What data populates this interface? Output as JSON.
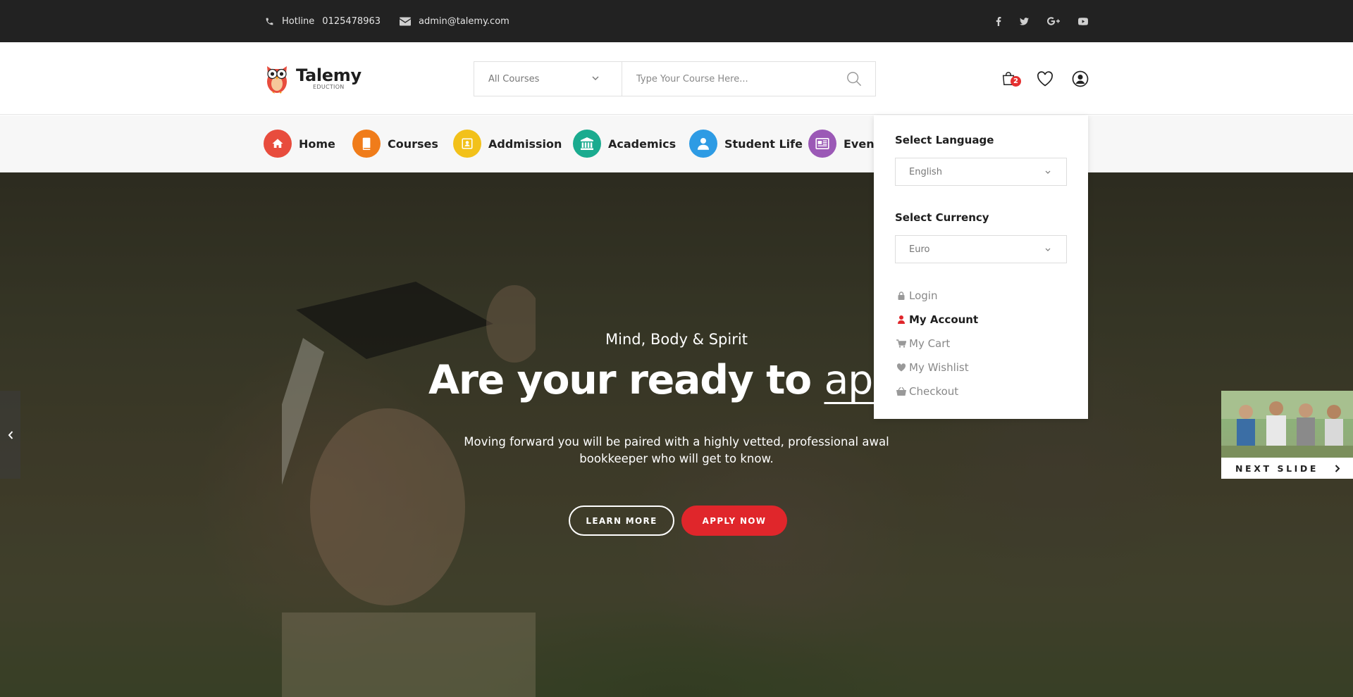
{
  "topbar": {
    "hotline_label": "Hotline",
    "hotline_number": "0125478963",
    "email": "admin@talemy.com",
    "social": [
      "facebook-icon",
      "twitter-icon",
      "google-plus-icon",
      "youtube-icon"
    ]
  },
  "header": {
    "logo_name": "Talemy",
    "logo_sub": "EDUCTION",
    "search_category": "All Courses",
    "search_placeholder": "Type Your Course Here...",
    "cart_count": "2"
  },
  "nav": {
    "items": [
      {
        "label": "Home",
        "color": "#e84c3d",
        "icon": "home-icon"
      },
      {
        "label": "Courses",
        "color": "#f07c1a",
        "icon": "book-icon"
      },
      {
        "label": "Addmission",
        "color": "#f2c11a",
        "icon": "id-card-icon"
      },
      {
        "label": "Academics",
        "color": "#1aab8f",
        "icon": "institution-icon"
      },
      {
        "label": "Student Life",
        "color": "#2e9be4",
        "icon": "user-icon"
      },
      {
        "label": "Events",
        "color": "#9b59b6",
        "icon": "newspaper-icon"
      }
    ]
  },
  "hero": {
    "subtitle": "Mind, Body & Spirit",
    "title_lead": "Are your ready to ",
    "title_underlined": "appl",
    "description": "Moving forward you will be paired with a highly vetted, professional awal bookkeeper who will get to know.",
    "learn_more": "LEARN MORE",
    "apply_now": "APPLY NOW",
    "next_slide": "NEXT SLIDE"
  },
  "dropdown": {
    "language_heading": "Select Language",
    "language_value": "English",
    "currency_heading": "Select Currency",
    "currency_value": "Euro",
    "links": [
      "Login",
      "My Account",
      "My Cart",
      "My Wishlist",
      "Checkout"
    ],
    "active_link": "My Account"
  },
  "colors": {
    "accent": "#e0262b",
    "topbar_bg": "#222222"
  }
}
